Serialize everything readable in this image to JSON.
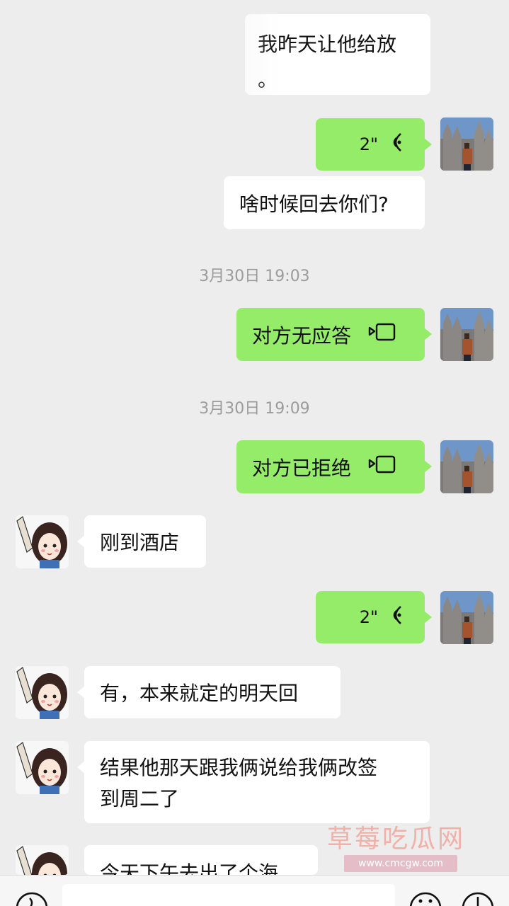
{
  "messages": {
    "top_partial": {
      "line1": "我昨天让他给放",
      "line2": "。"
    },
    "voice_1": {
      "duration": "2\""
    },
    "text_out_1": "啥时候回去你们?",
    "timestamp_1": "3月30日 19:03",
    "call_1": "对方无应答",
    "timestamp_2": "3月30日 19:09",
    "call_2": "对方已拒绝",
    "text_in_1": "刚到酒店",
    "voice_2": {
      "duration": "2\""
    },
    "text_in_2": "有，本来就定的明天回",
    "text_in_3": {
      "line1": "结果他那天跟我俩说给我俩改签",
      "line2": "到周二了"
    },
    "text_in_4_partial": "今天下午去出了个海"
  },
  "watermark": {
    "brand": "草莓吃瓜网",
    "url": "www.cmcgw.com"
  },
  "colors": {
    "outgoing": "#95ec69",
    "incoming": "#ffffff",
    "background": "#ededed",
    "timestamp": "#9b9b9b"
  },
  "icons": [
    "voice-wave-icon",
    "video-call-icon",
    "voice-mode-icon",
    "emoji-icon",
    "plus-icon"
  ]
}
